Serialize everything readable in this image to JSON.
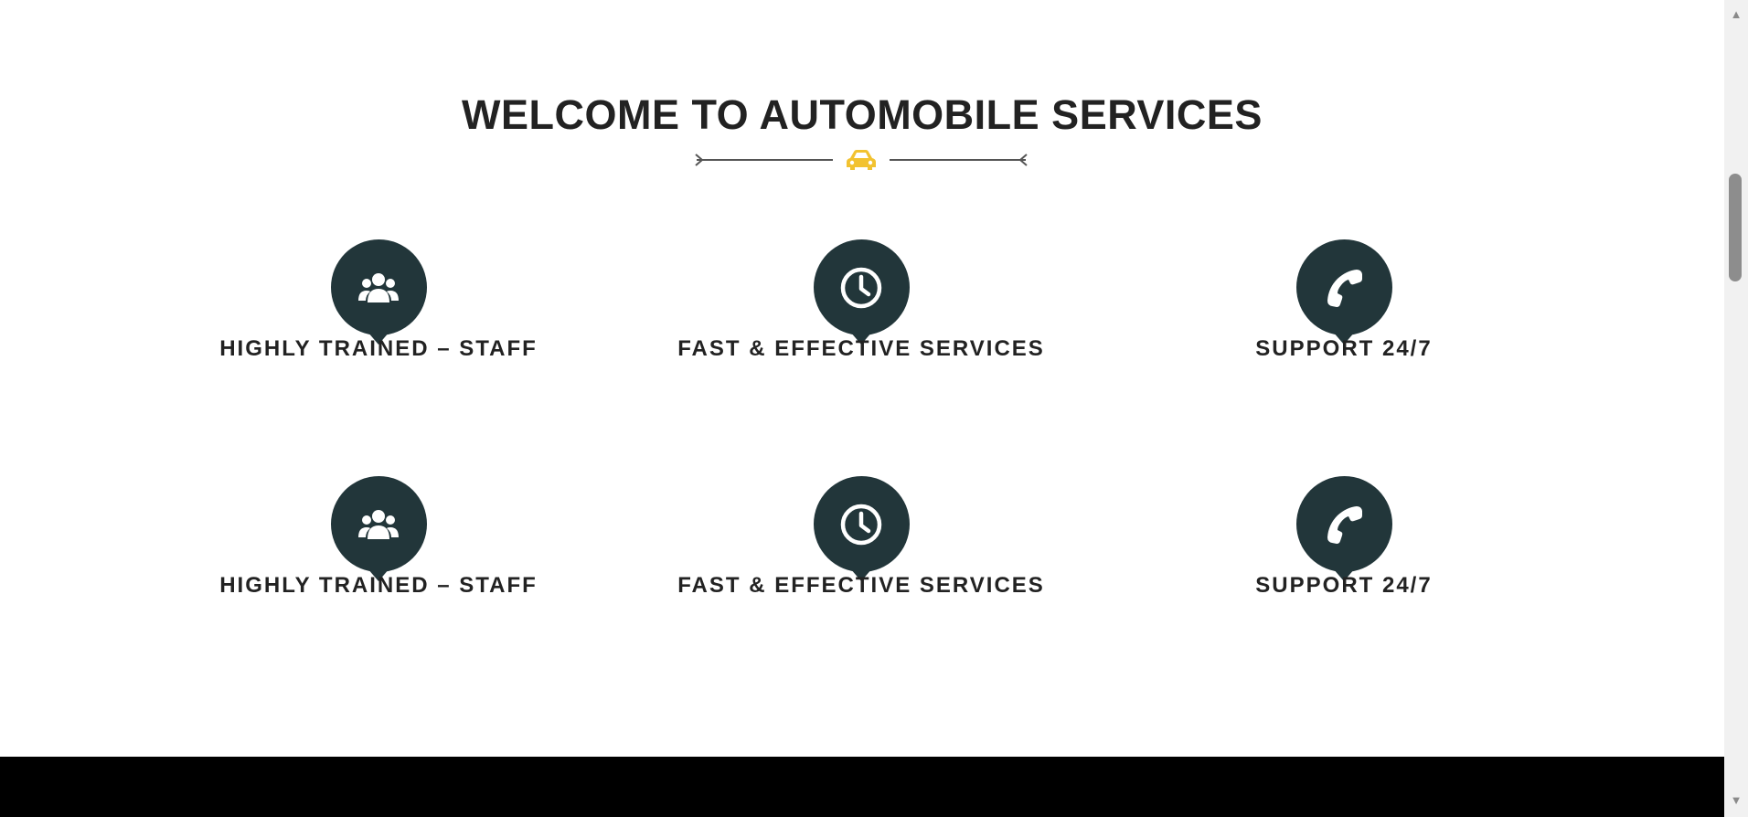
{
  "section": {
    "title": "WELCOME TO AUTOMOBILE SERVICES",
    "divider_icon": "car-icon"
  },
  "features": [
    {
      "title": "HIGHLY TRAINED – STAFF",
      "icon": "users-icon"
    },
    {
      "title": "FAST & EFFECTIVE SERVICES",
      "icon": "clock-icon"
    },
    {
      "title": "SUPPORT 24/7",
      "icon": "phone-icon"
    },
    {
      "title": "HIGHLY TRAINED – STAFF",
      "icon": "users-icon"
    },
    {
      "title": "FAST & EFFECTIVE SERVICES",
      "icon": "clock-icon"
    },
    {
      "title": "SUPPORT 24/7",
      "icon": "phone-icon"
    }
  ],
  "colors": {
    "bubble": "#22363a",
    "accent": "#f2c230",
    "text": "#222222",
    "footer": "#000000"
  },
  "scrollbar": {
    "up_arrow": "▲",
    "down_arrow": "▼"
  }
}
